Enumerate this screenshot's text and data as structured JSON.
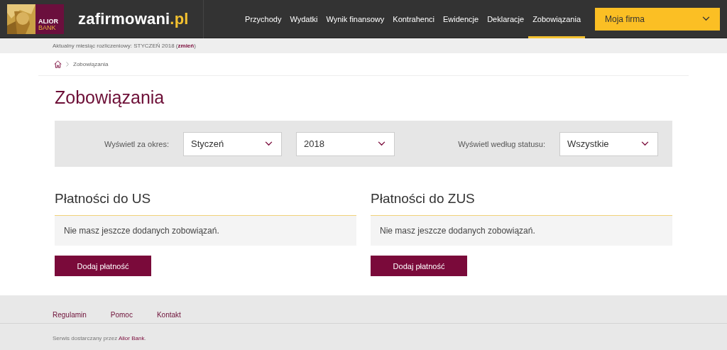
{
  "header": {
    "logo_text": [
      "ALIOR",
      "BANK"
    ],
    "site_name": "zafirmowani",
    "site_suffix": ".pl",
    "nav": [
      {
        "label": "Przychody",
        "selected": false
      },
      {
        "label": "Wydatki",
        "selected": false
      },
      {
        "label": "Wynik finansowy",
        "selected": false
      },
      {
        "label": "Kontrahenci",
        "selected": false
      },
      {
        "label": "Ewidencje",
        "selected": false
      },
      {
        "label": "Deklaracje",
        "selected": false
      },
      {
        "label": "Zobowiązania",
        "selected": true
      }
    ],
    "company_menu": "Moja firma"
  },
  "period_bar": {
    "text": "Aktualny miesiąc rozliczeniowy: STYCZEŃ 2018 (",
    "link": "zmień",
    "suffix": ")"
  },
  "breadcrumb": [
    "Zobowiązania"
  ],
  "title": "Zobowiązania",
  "filters": {
    "period_label": "Wyświetl za okres:",
    "month": "Styczeń",
    "year": "2018",
    "status_label": "Wyświetl według statusu:",
    "status": "Wszystkie"
  },
  "sections": [
    {
      "heading": "Płatności do US",
      "message": "Nie masz jeszcze dodanych zobowiązań.",
      "button": "Dodaj płatność"
    },
    {
      "heading": "Płatności do ZUS",
      "message": "Nie masz jeszcze dodanych zobowiązań.",
      "button": "Dodaj płatność"
    }
  ],
  "footer": {
    "links": [
      "Regulamin",
      "Pomoc",
      "Kontakt"
    ],
    "text": "Serwis dostarczany przez ",
    "link": "Alior Bank",
    "suffix": "."
  }
}
